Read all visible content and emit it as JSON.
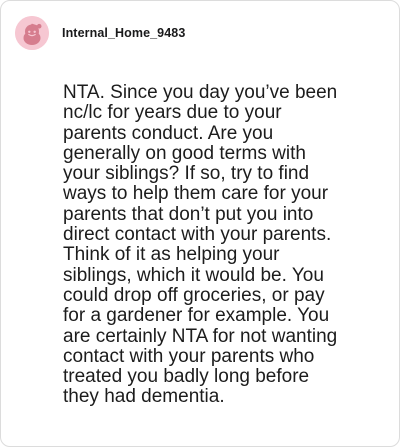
{
  "comment": {
    "author": {
      "username": "Internal_Home_9483",
      "avatar_icon": "reddit-snoo-avatar-icon",
      "avatar_bg": "#f6c7d2",
      "avatar_fg": "#d67d8e"
    },
    "body": "NTA. Since you day you’ve been\nnc/lc for years due to your\nparents conduct.  Are you\ngenerally on good terms with\nyour siblings?  If so, try to find\nways to help them care for your\nparents that don’t put you into\ndirect contact with your parents.\n Think of it as helping your\nsiblings, which it would be.  You\ncould drop off groceries, or pay\nfor a gardener for example.  You\nare certainly NTA for not wanting\ncontact with your parents who\ntreated you badly long before\nthey had dementia."
  }
}
